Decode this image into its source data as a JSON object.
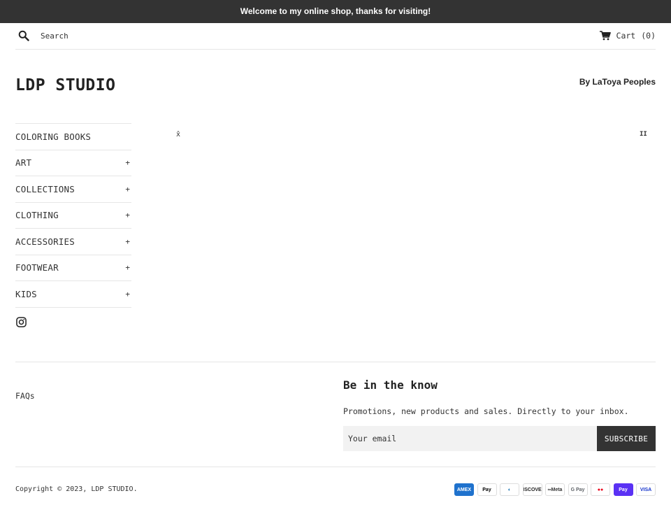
{
  "announcement": "Welcome to my online shop, thanks for visiting!",
  "header": {
    "search_placeholder": "Search",
    "cart_label": "Cart",
    "cart_count": "(0)"
  },
  "brand": {
    "logo": "LDP STUDIO",
    "tagline": "By LaToya Peoples"
  },
  "nav": {
    "items": [
      {
        "label": "COLORING BOOKS",
        "expandable": ""
      },
      {
        "label": "ART",
        "expandable": "+"
      },
      {
        "label": "COLLECTIONS",
        "expandable": "+"
      },
      {
        "label": "CLOTHING",
        "expandable": "+"
      },
      {
        "label": "ACCESSORIES",
        "expandable": "+"
      },
      {
        "label": "FOOTWEAR",
        "expandable": "+"
      },
      {
        "label": "KIDS",
        "expandable": "+"
      }
    ]
  },
  "slider": {
    "prev_glyph": "x̂",
    "pause_glyph": "II"
  },
  "footer": {
    "faqs_link": "FAQs",
    "newsletter_title": "Be in the know",
    "newsletter_text": "Promotions, new products and sales. Directly to your inbox.",
    "email_placeholder": "Your email",
    "subscribe_label": "SUBSCRIBE",
    "copyright": "Copyright © 2023, LDP STUDIO.",
    "payments": [
      {
        "name": "american-express-icon",
        "label": "AMEX",
        "bg": "#1f72cd",
        "fg": "#ffffff"
      },
      {
        "name": "apple-pay-icon",
        "label": " Pay",
        "bg": "#ffffff",
        "fg": "#000000"
      },
      {
        "name": "diners-club-icon",
        "label": "◐",
        "bg": "#ffffff",
        "fg": "#0165ac"
      },
      {
        "name": "discover-icon",
        "label": "DISCOVER",
        "bg": "#ffffff",
        "fg": "#222222"
      },
      {
        "name": "meta-pay-icon",
        "label": "∞Meta",
        "bg": "#ffffff",
        "fg": "#333333"
      },
      {
        "name": "google-pay-icon",
        "label": "G Pay",
        "bg": "#ffffff",
        "fg": "#5f6368"
      },
      {
        "name": "mastercard-icon",
        "label": "●●",
        "bg": "#ffffff",
        "fg": "#eb001b"
      },
      {
        "name": "shop-pay-icon",
        "label": "Pay",
        "bg": "#5a31f4",
        "fg": "#ffffff"
      },
      {
        "name": "visa-icon",
        "label": "VISA",
        "bg": "#ffffff",
        "fg": "#1434cb"
      }
    ]
  }
}
